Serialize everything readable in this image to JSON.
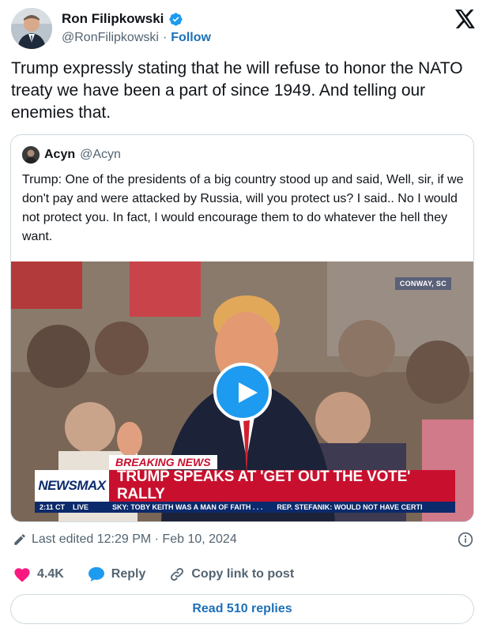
{
  "author": {
    "display_name": "Ron Filipkowski",
    "handle": "@RonFilipkowski",
    "separator": "·",
    "follow_label": "Follow"
  },
  "tweet_text": "Trump expressly stating that he will refuse to honor the NATO treaty we have been a part of since 1949. And telling our enemies that.",
  "quote": {
    "display_name": "Acyn",
    "handle": "@Acyn",
    "text": "Trump: One of the presidents of a big country stood up and said, Well, sir, if we don't pay and were attacked by Russia, will you protect us? I said.. No I would not protect you. In fact, I would encourage them to do whatever the hell they want.",
    "video": {
      "location": "CONWAY, SC",
      "breaking": "BREAKING NEWS",
      "network": "NEWSMAX",
      "headline": "TRUMP SPEAKS AT 'GET OUT THE VOTE' RALLY",
      "time": "2:11 CT",
      "live": "LIVE",
      "ticker_1": "SKY: TOBY KEITH WAS A MAN OF FAITH . . .",
      "ticker_2": "REP. STEFANIK: WOULD NOT HAVE CERTI"
    }
  },
  "edited_text": "Last edited 12:29 PM · Feb 10, 2024",
  "actions": {
    "likes": "4.4K",
    "reply": "Reply",
    "copy": "Copy link to post"
  },
  "read_replies": "Read 510 replies",
  "colors": {
    "accent": "#1d9bf0",
    "link": "#1d70b8",
    "like": "#f91880",
    "newsmax_red": "#c8102e",
    "newsmax_blue": "#0b2a6b"
  }
}
